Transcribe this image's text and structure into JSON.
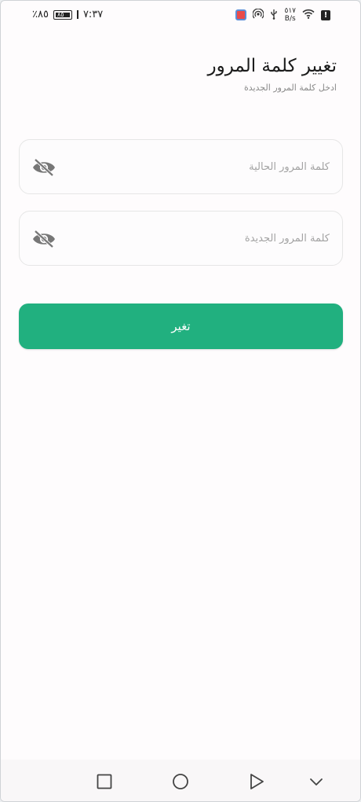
{
  "status_bar": {
    "time": "٧:٣٧",
    "battery_level": "٨٥",
    "battery_percent": "٪٨٥",
    "net_speed_value": "٥١٧",
    "net_speed_unit": "B/s"
  },
  "header": {
    "title": "تغيير كلمة المرور",
    "subtitle": "ادخل كلمة المرور الجديدة"
  },
  "form": {
    "current_password": {
      "value": "",
      "placeholder": "كلمة المرور الحالية"
    },
    "new_password": {
      "value": "",
      "placeholder": "كلمة المرور الجديدة"
    },
    "submit_label": "تغير"
  },
  "colors": {
    "accent": "#21b07f",
    "background": "#fefcfd",
    "field_border": "#e6e6e6",
    "icon": "#777777"
  },
  "icons": {
    "password_toggle": "eye-slash-icon",
    "nav": [
      "square-icon",
      "circle-icon",
      "triangle-back-icon",
      "chevron-down-icon"
    ]
  }
}
